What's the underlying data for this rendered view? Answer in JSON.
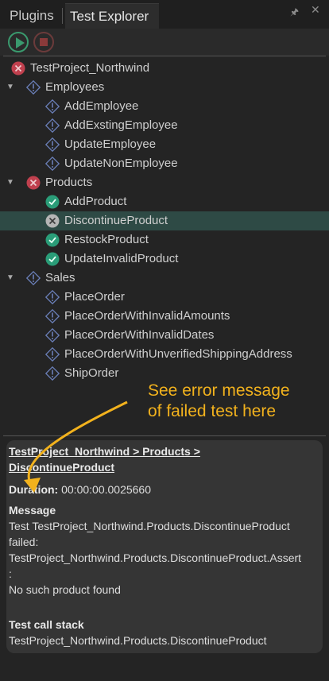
{
  "tabs": {
    "plugins": "Plugins",
    "test_explorer": "Test Explorer"
  },
  "tree": {
    "project": "TestProject_Northwind",
    "employees": {
      "label": "Employees",
      "tests": [
        "AddEmployee",
        "AddExstingEmployee",
        "UpdateEmployee",
        "UpdateNonEmployee"
      ]
    },
    "products": {
      "label": "Products",
      "tests": [
        "AddProduct",
        "DiscontinueProduct",
        "RestockProduct",
        "UpdateInvalidProduct"
      ]
    },
    "sales": {
      "label": "Sales",
      "tests": [
        "PlaceOrder",
        "PlaceOrderWithInvalidAmounts",
        "PlaceOrderWithInvalidDates",
        "PlaceOrderWithUnverifiedShippingAddress",
        "ShipOrder"
      ]
    }
  },
  "annotation": {
    "line1": "See error message",
    "line2": "of failed test here"
  },
  "details": {
    "path_line1": "TestProject_Northwind > Products >",
    "path_line2": "DiscontinueProduct",
    "duration_label": "Duration:",
    "duration_value": "00:00:00.0025660",
    "message_label": "Message",
    "message_line1": "Test TestProject_Northwind.Products.DiscontinueProduct",
    "message_line2": "failed:",
    "message_line3": "TestProject_Northwind.Products.DiscontinueProduct.Assert",
    "message_line4": ":",
    "message_line5": "No such product found",
    "stack_label": "Test call stack",
    "stack_value": "TestProject_Northwind.Products.DiscontinueProduct"
  },
  "colors": {
    "failed": "#c0404e",
    "passed": "#2a9d78",
    "not_run": "#6a7fb8",
    "accent": "#f2b21d",
    "selected_row": "#2e4a45"
  }
}
